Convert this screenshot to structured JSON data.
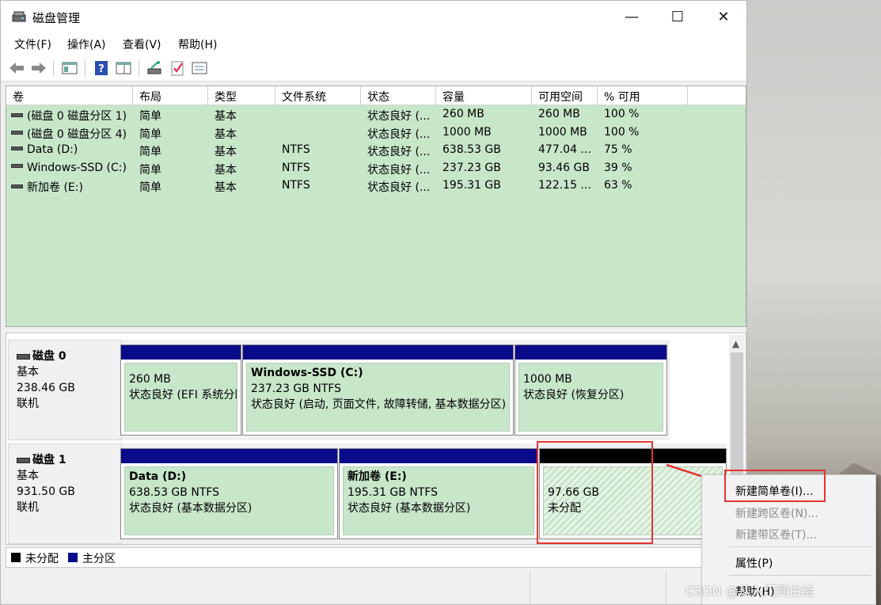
{
  "window": {
    "title": "磁盘管理",
    "controls": {
      "minimize": "—",
      "maximize": "☐",
      "close": "✕"
    }
  },
  "menu": [
    "文件(F)",
    "操作(A)",
    "查看(V)",
    "帮助(H)"
  ],
  "volume_list": {
    "columns": [
      "卷",
      "布局",
      "类型",
      "文件系统",
      "状态",
      "容量",
      "可用空间",
      "% 可用"
    ],
    "rows": [
      {
        "volume": "(磁盘 0 磁盘分区 1)",
        "layout": "简单",
        "type": "基本",
        "fs": "",
        "status": "状态良好 (...",
        "capacity": "260 MB",
        "free": "260 MB",
        "pct": "100 %"
      },
      {
        "volume": "(磁盘 0 磁盘分区 4)",
        "layout": "简单",
        "type": "基本",
        "fs": "",
        "status": "状态良好 (...",
        "capacity": "1000 MB",
        "free": "1000 MB",
        "pct": "100 %"
      },
      {
        "volume": "Data (D:)",
        "layout": "简单",
        "type": "基本",
        "fs": "NTFS",
        "status": "状态良好 (...",
        "capacity": "638.53 GB",
        "free": "477.04 ...",
        "pct": "75 %"
      },
      {
        "volume": "Windows-SSD (C:)",
        "layout": "简单",
        "type": "基本",
        "fs": "NTFS",
        "status": "状态良好 (...",
        "capacity": "237.23 GB",
        "free": "93.46 GB",
        "pct": "39 %"
      },
      {
        "volume": "新加卷 (E:)",
        "layout": "简单",
        "type": "基本",
        "fs": "NTFS",
        "status": "状态良好 (...",
        "capacity": "195.31 GB",
        "free": "122.15 ...",
        "pct": "63 %"
      }
    ]
  },
  "disks": [
    {
      "name": "磁盘 0",
      "type": "基本",
      "size": "238.46 GB",
      "state": "联机",
      "partitions": [
        {
          "title": "",
          "line1": "260 MB",
          "line2": "状态良好 (EFI 系统分区)"
        },
        {
          "title": "Windows-SSD  (C:)",
          "line1": "237.23 GB NTFS",
          "line2": "状态良好 (启动, 页面文件, 故障转储, 基本数据分区)"
        },
        {
          "title": "",
          "line1": "1000 MB",
          "line2": "状态良好 (恢复分区)"
        }
      ]
    },
    {
      "name": "磁盘 1",
      "type": "基本",
      "size": "931.50 GB",
      "state": "联机",
      "partitions": [
        {
          "title": "Data  (D:)",
          "line1": "638.53 GB NTFS",
          "line2": "状态良好 (基本数据分区)"
        },
        {
          "title": "新加卷  (E:)",
          "line1": "195.31 GB NTFS",
          "line2": "状态良好 (基本数据分区)"
        },
        {
          "title": "",
          "line1": "97.66 GB",
          "line2": "未分配"
        }
      ]
    }
  ],
  "legend": {
    "unallocated": "未分配",
    "primary": "主分区"
  },
  "colors": {
    "primary": "#0a0a8a",
    "unallocated": "#000000",
    "volume_fill": "#c8e6c9",
    "highlight": "#e53333"
  },
  "context_menu": {
    "new_simple": "新建简单卷(I)...",
    "new_spanned": "新建跨区卷(N)...",
    "new_striped": "新建带区卷(T)...",
    "properties": "属性(P)",
    "help": "帮助(H)"
  },
  "watermark": "CSDN @从入门到白给"
}
